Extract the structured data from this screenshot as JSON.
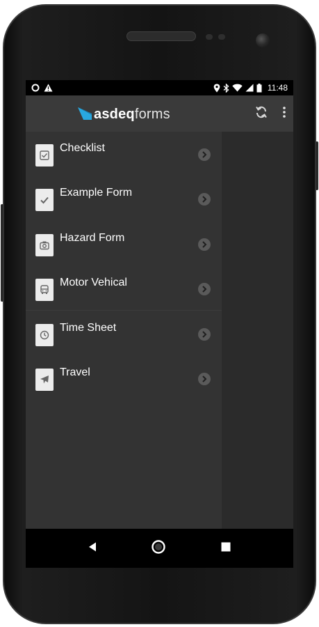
{
  "status_bar": {
    "time": "11:48",
    "left_icons": [
      "circle-notification-icon",
      "warning-icon"
    ],
    "right_icons": [
      "location-icon",
      "bluetooth-icon",
      "wifi-icon",
      "signal-icon",
      "battery-icon"
    ]
  },
  "app_bar": {
    "brand_bold": "asdeq",
    "brand_light": "forms",
    "actions": [
      "sync-icon",
      "more-vert-icon"
    ]
  },
  "forms": [
    {
      "label": "Checklist",
      "icon": "checklist-icon"
    },
    {
      "label": "Example Form",
      "icon": "checkmark-icon"
    },
    {
      "label": "Hazard Form",
      "icon": "camera-icon"
    },
    {
      "label": "Motor Vehical",
      "icon": "bus-icon"
    },
    {
      "label": "Time Sheet",
      "icon": "clock-icon"
    },
    {
      "label": "Travel",
      "icon": "airplane-icon"
    }
  ],
  "nav_bar": [
    "back-icon",
    "home-icon",
    "recents-icon"
  ],
  "colors": {
    "screen_bg": "#2f2f2f",
    "app_bar": "#3a3a3a",
    "drawer_bg": "#333333",
    "brand_accent": "#29a8e0"
  }
}
